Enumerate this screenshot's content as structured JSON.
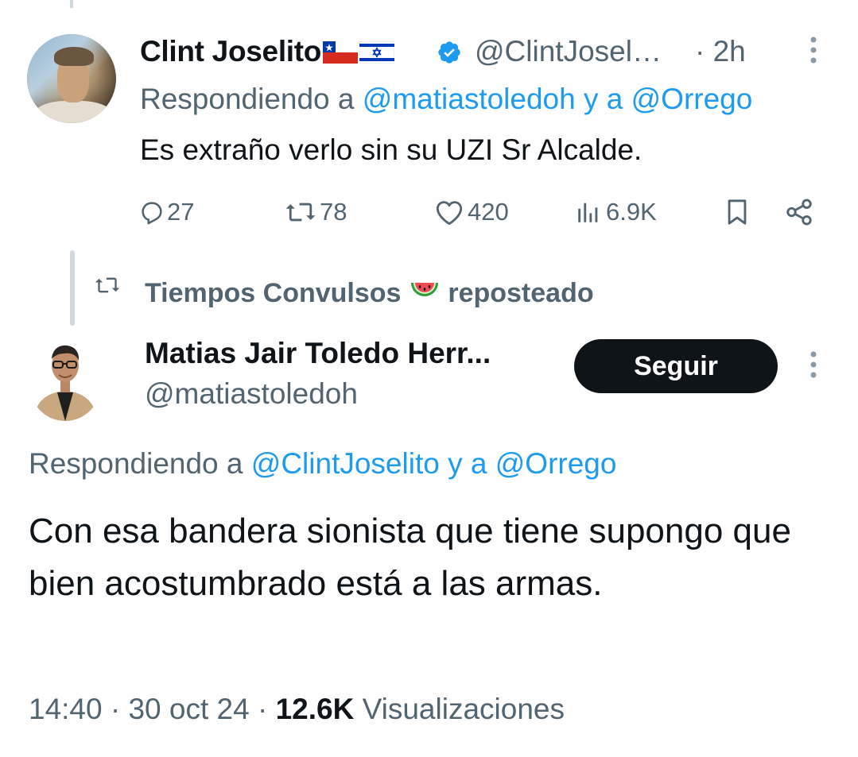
{
  "tweet1": {
    "display_name": "Clint Joselito",
    "handle": "@ClintJosel…",
    "time": "· 2h",
    "reply_prefix": "Respondiendo a",
    "reply_mentions": "@matiastoledoh y a @Orrego",
    "text": "Es extraño verlo sin su UZI Sr Alcalde.",
    "stats": {
      "replies": "27",
      "reposts": "78",
      "likes": "420",
      "views": "6.9K"
    },
    "icons": [
      "verified-badge-icon",
      "chile-flag-icon",
      "israel-flag-icon",
      "more-options-icon",
      "reply-icon",
      "repost-icon",
      "like-icon",
      "views-icon",
      "bookmark-icon",
      "share-icon"
    ]
  },
  "repost_banner": {
    "text": "Tiempos Convulsos",
    "suffix": "reposteado",
    "emoji": "🍉"
  },
  "tweet2": {
    "display_name": "Matias Jair Toledo Herr...",
    "handle": "@matiastoledoh",
    "follow_label": "Seguir",
    "reply_prefix": "Respondiendo a",
    "reply_mentions": "@ClintJoselito y a @Orrego",
    "text": "Con esa bandera sionista que tiene supongo que bien acostumbrado está a las armas.",
    "time": "14:40",
    "date": "30 oct 24",
    "views_count": "12.6K",
    "views_label": "Visualizaciones"
  },
  "colors": {
    "text": "#0f1419",
    "secondary": "#536471",
    "link": "#1d9bf0",
    "verified": "#1d9bf0",
    "button_bg": "#0f1419",
    "thread_line": "#cfd9de"
  }
}
